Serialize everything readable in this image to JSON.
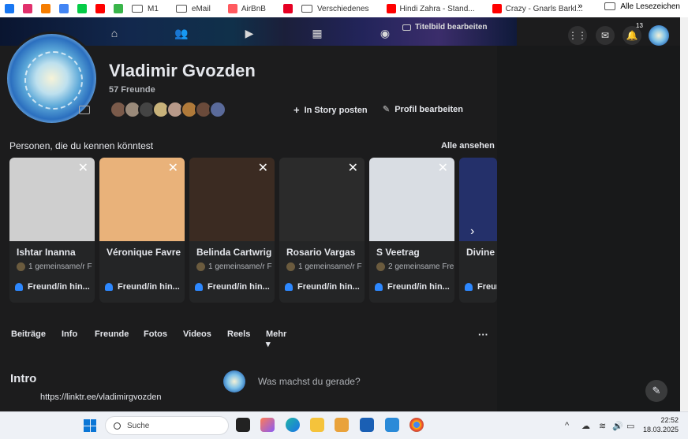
{
  "bookmarks": [
    {
      "label": "",
      "icon": "facebook-icon",
      "color": "#1877f2"
    },
    {
      "label": "",
      "icon": "instagram-icon",
      "color": "#e1306c"
    },
    {
      "label": "",
      "icon": "blogger-icon",
      "color": "#f57d00"
    },
    {
      "label": "",
      "icon": "google-icon",
      "color": "#4285f4"
    },
    {
      "label": "",
      "icon": "deviantart-icon",
      "color": "#05cc47"
    },
    {
      "label": "",
      "icon": "youtube-icon",
      "color": "#ff0000"
    },
    {
      "label": "",
      "icon": "lotus-icon",
      "color": "#39b54a"
    },
    {
      "label": "M1",
      "icon": "folder-icon"
    },
    {
      "label": "eMail",
      "icon": "folder-icon"
    },
    {
      "label": "AirBnB",
      "icon": "airbnb-icon",
      "color": "#ff5a5f"
    },
    {
      "label": "",
      "icon": "pinterest-icon",
      "color": "#e60023"
    },
    {
      "label": "Verschiedenes",
      "icon": "folder-icon"
    },
    {
      "label": "Hindi Zahra - Stand...",
      "icon": "youtube-icon",
      "color": "#ff0000"
    },
    {
      "label": "Crazy - Gnarls Barkl...",
      "icon": "youtube-icon",
      "color": "#ff0000"
    }
  ],
  "bookmarks_more": "»",
  "bookmarks_all": "Alle Lesezeichen",
  "topnav": {
    "titelbild_label": "Titelbild bearbeiten",
    "notification_count": "13"
  },
  "profile": {
    "name": "Vladimir Gvozden",
    "friend_count": "57 Freunde",
    "story_label": "In Story posten",
    "edit_label": "Profil bearbeiten"
  },
  "suggestions": {
    "title": "Personen, die du kennen könntest",
    "see_all": "Alle ansehen",
    "add_label": "Freund/in hin...",
    "add_label_cut": "Freun",
    "cards": [
      {
        "name": "Ishtar Inanna",
        "mutual": "1 gemeinsame/r F",
        "photo_color": "#cfcfcf"
      },
      {
        "name": "Véronique Favre",
        "mutual": "",
        "photo_color": "#e9b27a"
      },
      {
        "name": "Belinda Cartwrig",
        "mutual": "1 gemeinsame/r F",
        "photo_color": "#3b2b22"
      },
      {
        "name": "Rosario Vargas",
        "mutual": "1 gemeinsame/r F",
        "photo_color": "#2b2b2b"
      },
      {
        "name": "S Veetrag",
        "mutual": "2 gemeinsame Fre",
        "photo_color": "#d9dde3"
      },
      {
        "name": "Divine I",
        "mutual": "",
        "photo_color": "#24306a"
      }
    ]
  },
  "tabs": [
    "Beiträge",
    "Info",
    "Freunde",
    "Fotos",
    "Videos",
    "Reels",
    "Mehr ▾"
  ],
  "tabs_more": "···",
  "intro": {
    "title": "Intro",
    "link": "https://linktr.ee/vladimirgvozden"
  },
  "composer": {
    "prompt": "Was machst du gerade?"
  },
  "taskbar": {
    "search_label": "Suche",
    "time": "22:52",
    "date": "18.03.2025"
  }
}
